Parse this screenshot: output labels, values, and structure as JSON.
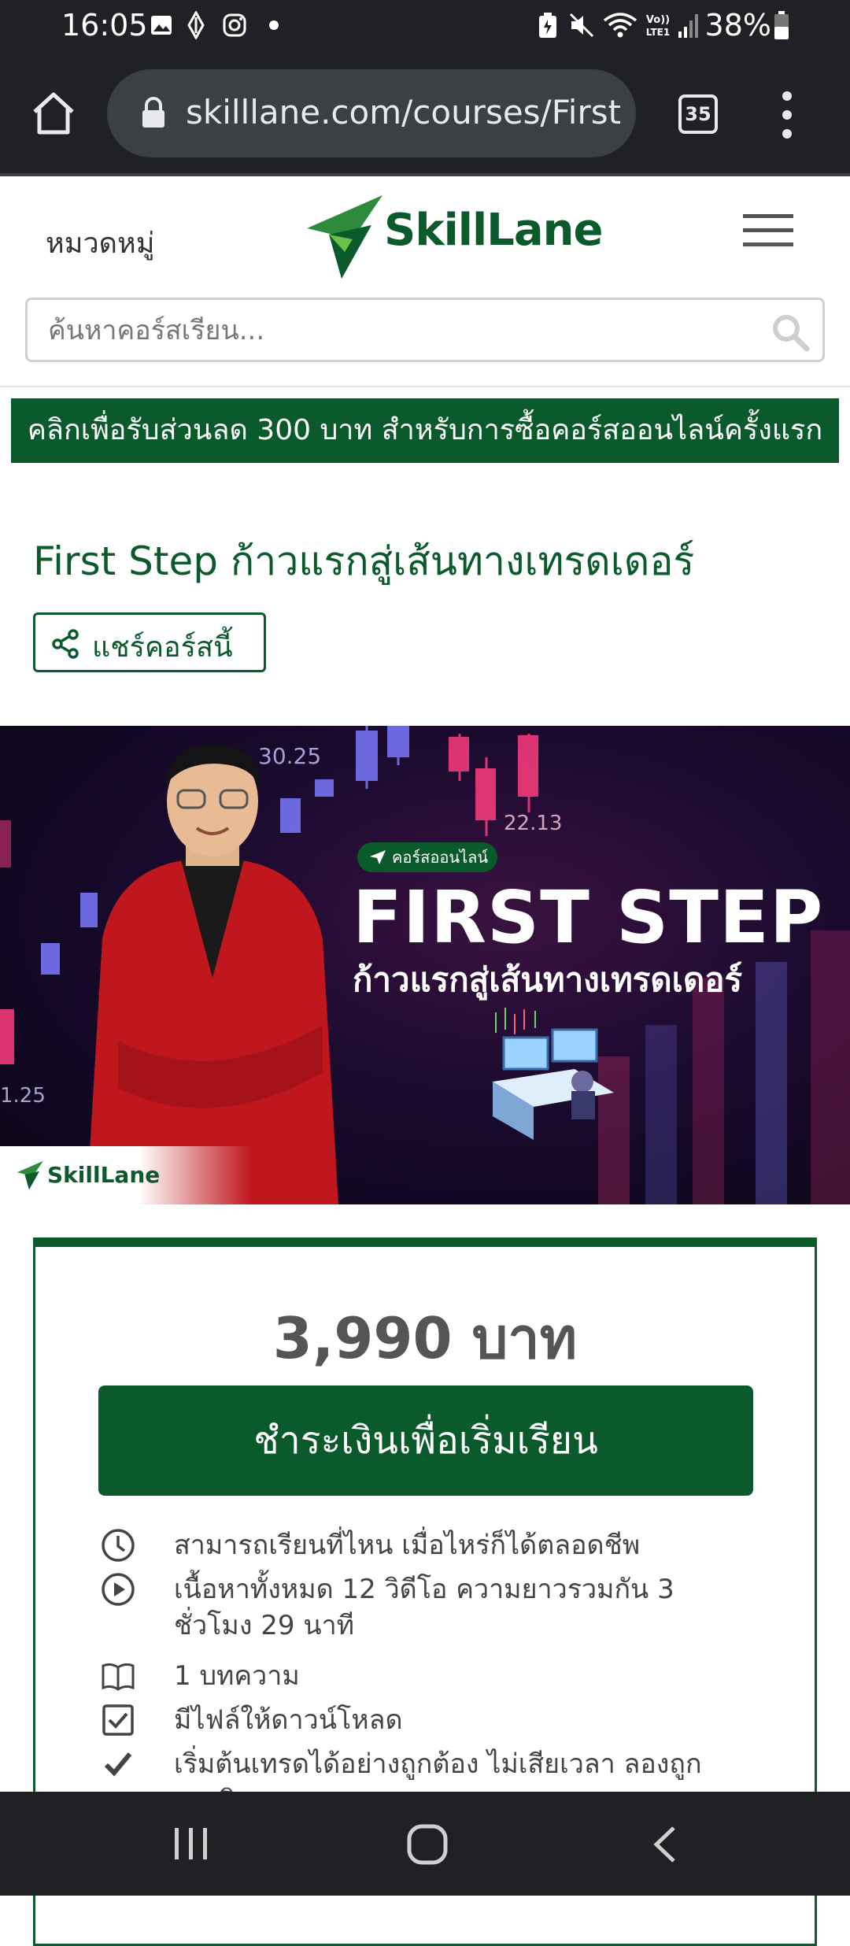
{
  "status_bar": {
    "time": "16:05",
    "battery": "38%",
    "network": "VoLTE1"
  },
  "browser": {
    "url": "skilllane.com/courses/First",
    "tab_count": "35"
  },
  "header": {
    "categories_label": "หมวดหมู่",
    "logo_text": "SkillLane",
    "search_placeholder": "ค้นหาคอร์สเรียน..."
  },
  "promo": {
    "text": "คลิกเพื่อรับส่วนลด 300 บาท สำหรับการซื้อคอร์สออนไลน์ครั้งแรก"
  },
  "course": {
    "title": "First Step ก้าวแรกสู่เส้นทางเทรดเดอร์",
    "share_label": "แชร์คอร์สนี้"
  },
  "hero": {
    "badge": "คอร์สออนไลน์",
    "title": "FIRST STEP",
    "subtitle": "ก้าวแรกสู่เส้นทางเทรดเดอร์",
    "brand": "SkillLane",
    "chart_labels": [
      "30.25",
      "22.13",
      "1.25"
    ]
  },
  "purchase": {
    "price": "3,990 บาท",
    "pay_label": "ชำระเงินเพื่อเริ่มเรียน",
    "features": [
      {
        "icon": "clock-icon",
        "text": "สามารถเรียนที่ไหน เมื่อไหร่ก็ได้ตลอดชีพ"
      },
      {
        "icon": "play-circle-icon",
        "text": "เนื้อหาทั้งหมด 12 วิดีโอ ความยาวรวมกัน 3 ชั่วโมง 29 นาที"
      },
      {
        "icon": "book-icon",
        "text": "1 บทความ"
      },
      {
        "icon": "checkbox-icon",
        "text": "มีไฟล์ให้ดาวน์โหลด"
      },
      {
        "icon": "checkmark-icon",
        "text": "เริ่มต้นเทรดได้อย่างถูกต้อง ไม่เสียเวลา ลองถูกลองผิด"
      }
    ]
  },
  "colors": {
    "brand_green": "#0b5a2b",
    "system_dark": "#202124"
  }
}
